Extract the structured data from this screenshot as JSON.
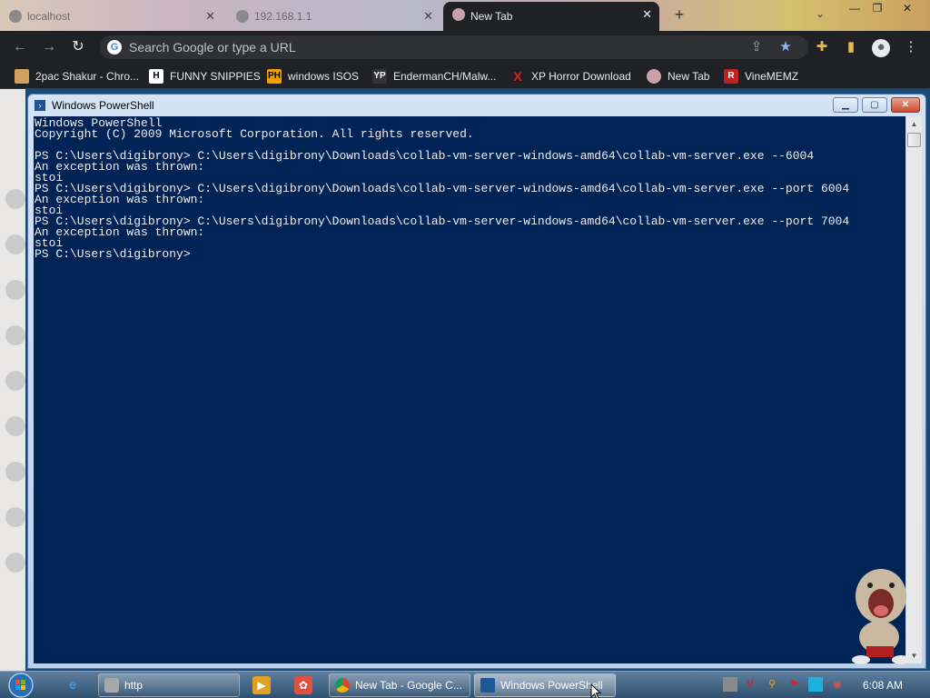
{
  "browser": {
    "tabs": [
      {
        "label": "localhost",
        "active": false
      },
      {
        "label": "192.168.1.1",
        "active": false
      },
      {
        "label": "New Tab",
        "active": true
      }
    ],
    "omnibox": {
      "placeholder": "Search Google or type a URL"
    },
    "bookmarks": [
      {
        "label": "2pac Shakur - Chro...",
        "icon": "folder-icon",
        "color": "#d0a060"
      },
      {
        "label": "FUNNY SNIPPIES",
        "icon": "h-logo-icon",
        "color": "#ffffff"
      },
      {
        "label": "windows ISOS",
        "icon": "ph-logo-icon",
        "color": "#f0a000"
      },
      {
        "label": "EndermanCH/Malw...",
        "icon": "yp-logo-icon",
        "color": "#333333"
      },
      {
        "label": "XP Horror Download",
        "icon": "x-logo-icon",
        "color": "#e02020"
      },
      {
        "label": "New Tab",
        "icon": "chrome-ball-icon",
        "color": "#c77"
      },
      {
        "label": "VineMEMZ",
        "icon": "r-logo-icon",
        "color": "#c02020"
      }
    ]
  },
  "powershell": {
    "title": "Windows PowerShell",
    "console_text": "Windows PowerShell\nCopyright (C) 2009 Microsoft Corporation. All rights reserved.\n\nPS C:\\Users\\digibrony> C:\\Users\\digibrony\\Downloads\\collab-vm-server-windows-amd64\\collab-vm-server.exe --6004\nAn exception was thrown:\nstoi\nPS C:\\Users\\digibrony> C:\\Users\\digibrony\\Downloads\\collab-vm-server-windows-amd64\\collab-vm-server.exe --port 6004\nAn exception was thrown:\nstoi\nPS C:\\Users\\digibrony> C:\\Users\\digibrony\\Downloads\\collab-vm-server-windows-amd64\\collab-vm-server.exe --port 7004\nAn exception was thrown:\nstoi\nPS C:\\Users\\digibrony>"
  },
  "taskbar": {
    "buttons": [
      {
        "label": "http",
        "active": false
      },
      {
        "label": "New Tab - Google C...",
        "active": false
      },
      {
        "label": "Windows PowerShell",
        "active": true
      }
    ],
    "clock": "6:08 AM"
  },
  "colors": {
    "console_bg": "#012456",
    "console_fg": "#eeedf0",
    "chrome_dark": "#202124"
  }
}
